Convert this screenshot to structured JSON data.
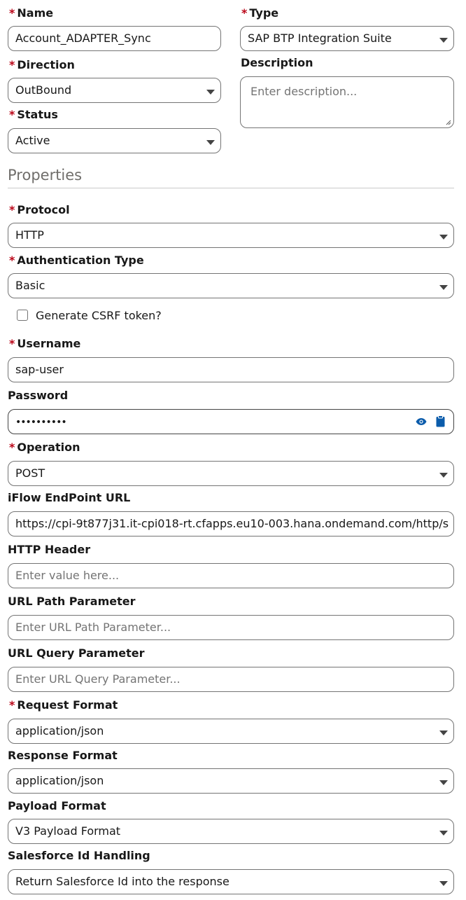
{
  "form": {
    "name": {
      "label": "Name",
      "value": "Account_ADAPTER_Sync"
    },
    "type": {
      "label": "Type",
      "value": "SAP BTP Integration Suite"
    },
    "direction": {
      "label": "Direction",
      "value": "OutBound"
    },
    "description": {
      "label": "Description",
      "placeholder": "Enter description..."
    },
    "status": {
      "label": "Status",
      "value": "Active"
    }
  },
  "properties": {
    "title": "Properties",
    "protocol": {
      "label": "Protocol",
      "value": "HTTP"
    },
    "auth_type": {
      "label": "Authentication Type",
      "value": "Basic"
    },
    "csrf": {
      "label": "Generate CSRF token?",
      "checked": false
    },
    "username": {
      "label": "Username",
      "value": "sap-user"
    },
    "password": {
      "label": "Password",
      "value": "••••••••••"
    },
    "operation": {
      "label": "Operation",
      "value": "POST"
    },
    "endpoint": {
      "label": "iFlow EndPoint URL",
      "value": "https://cpi-9t877j31.it-cpi018-rt.cfapps.eu10-003.hana.ondemand.com/http/s"
    },
    "http_header": {
      "label": "HTTP Header",
      "placeholder": "Enter value here..."
    },
    "url_path": {
      "label": "URL Path Parameter",
      "placeholder": "Enter URL Path Parameter..."
    },
    "url_query": {
      "label": "URL Query Parameter",
      "placeholder": "Enter URL Query Parameter..."
    },
    "request_format": {
      "label": "Request Format",
      "value": "application/json"
    },
    "response_format": {
      "label": "Response Format",
      "value": "application/json"
    },
    "payload_format": {
      "label": "Payload Format",
      "value": "V3 Payload Format"
    },
    "sf_id_handling": {
      "label": "Salesforce Id Handling",
      "value": "Return Salesforce Id into the response"
    }
  },
  "required_marker": "*",
  "colors": {
    "required": "#ba0517",
    "icon_blue": "#0b5cab",
    "border": "#747474"
  },
  "icons": {
    "reveal": "eye-icon",
    "copy": "clipboard-icon",
    "dropdown": "chevron-down-icon"
  }
}
